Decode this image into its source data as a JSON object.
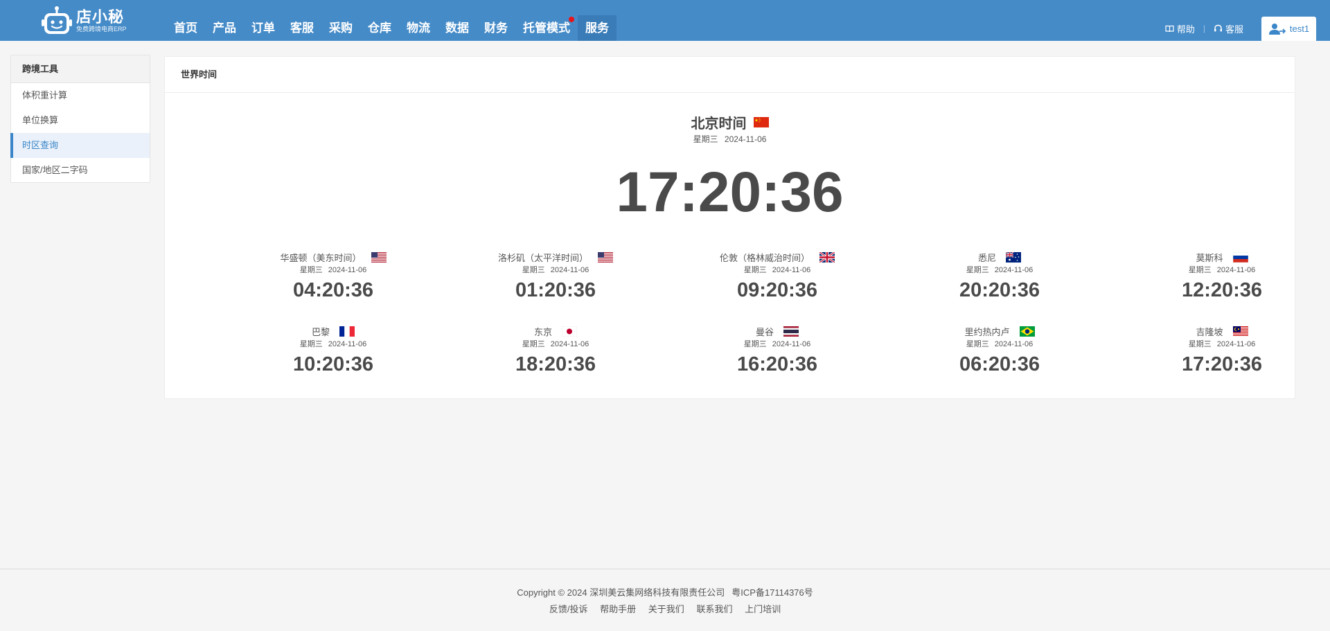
{
  "header": {
    "logo": {
      "brand": "店小秘",
      "slogan": "免费跨境电商ERP"
    },
    "nav": [
      {
        "label": "首页"
      },
      {
        "label": "产品"
      },
      {
        "label": "订单"
      },
      {
        "label": "客服"
      },
      {
        "label": "采购"
      },
      {
        "label": "仓库"
      },
      {
        "label": "物流"
      },
      {
        "label": "数据"
      },
      {
        "label": "财务"
      },
      {
        "label": "托管模式"
      },
      {
        "label": "服务"
      }
    ],
    "active_nav": "服务",
    "help_label": "帮助",
    "sep": "|",
    "service_label": "客服",
    "user_label": "test1"
  },
  "sidebar": {
    "title": "跨境工具",
    "items": [
      {
        "label": "体积重计算"
      },
      {
        "label": "单位换算"
      },
      {
        "label": "时区查询"
      },
      {
        "label": "国家/地区二字码"
      }
    ],
    "active_item": "时区查询"
  },
  "panel": {
    "title": "世界时间",
    "main": {
      "city": "北京时间",
      "flag": "cn-flag",
      "weekday": "星期三",
      "date": "2024-11-06",
      "time": "17:20:36"
    },
    "cities": [
      {
        "name": "华盛顿（美东时间）",
        "flag": "us-flag",
        "weekday": "星期三",
        "date": "2024-11-06",
        "time": "04:20:36"
      },
      {
        "name": "洛杉矶（太平洋时间）",
        "flag": "us-flag",
        "weekday": "星期三",
        "date": "2024-11-06",
        "time": "01:20:36"
      },
      {
        "name": "伦敦（格林威治时间）",
        "flag": "uk-flag",
        "weekday": "星期三",
        "date": "2024-11-06",
        "time": "09:20:36"
      },
      {
        "name": "悉尼",
        "flag": "au-flag",
        "weekday": "星期三",
        "date": "2024-11-06",
        "time": "20:20:36"
      },
      {
        "name": "莫斯科",
        "flag": "ru-flag",
        "weekday": "星期三",
        "date": "2024-11-06",
        "time": "12:20:36"
      },
      {
        "name": "巴黎",
        "flag": "fr-flag",
        "weekday": "星期三",
        "date": "2024-11-06",
        "time": "10:20:36"
      },
      {
        "name": "东京",
        "flag": "jp-flag",
        "weekday": "星期三",
        "date": "2024-11-06",
        "time": "18:20:36"
      },
      {
        "name": "曼谷",
        "flag": "th-flag",
        "weekday": "星期三",
        "date": "2024-11-06",
        "time": "16:20:36"
      },
      {
        "name": "里约热内卢",
        "flag": "br-flag",
        "weekday": "星期三",
        "date": "2024-11-06",
        "time": "06:20:36"
      },
      {
        "name": "吉隆坡",
        "flag": "my-flag",
        "weekday": "星期三",
        "date": "2024-11-06",
        "time": "17:20:36"
      }
    ]
  },
  "footer": {
    "copyright": "Copyright © 2024 深圳美云集网络科技有限责任公司",
    "icp": "粤ICP备17114376号",
    "links": [
      {
        "label": "反馈/投诉"
      },
      {
        "label": "帮助手册"
      },
      {
        "label": "关于我们"
      },
      {
        "label": "联系我们"
      },
      {
        "label": "上门培训"
      }
    ]
  },
  "colors": {
    "header_bg": "#458bc8",
    "nav_active_bg": "#3a7cb8",
    "accent": "#3a86c8",
    "badge_red": "#e8141b"
  }
}
